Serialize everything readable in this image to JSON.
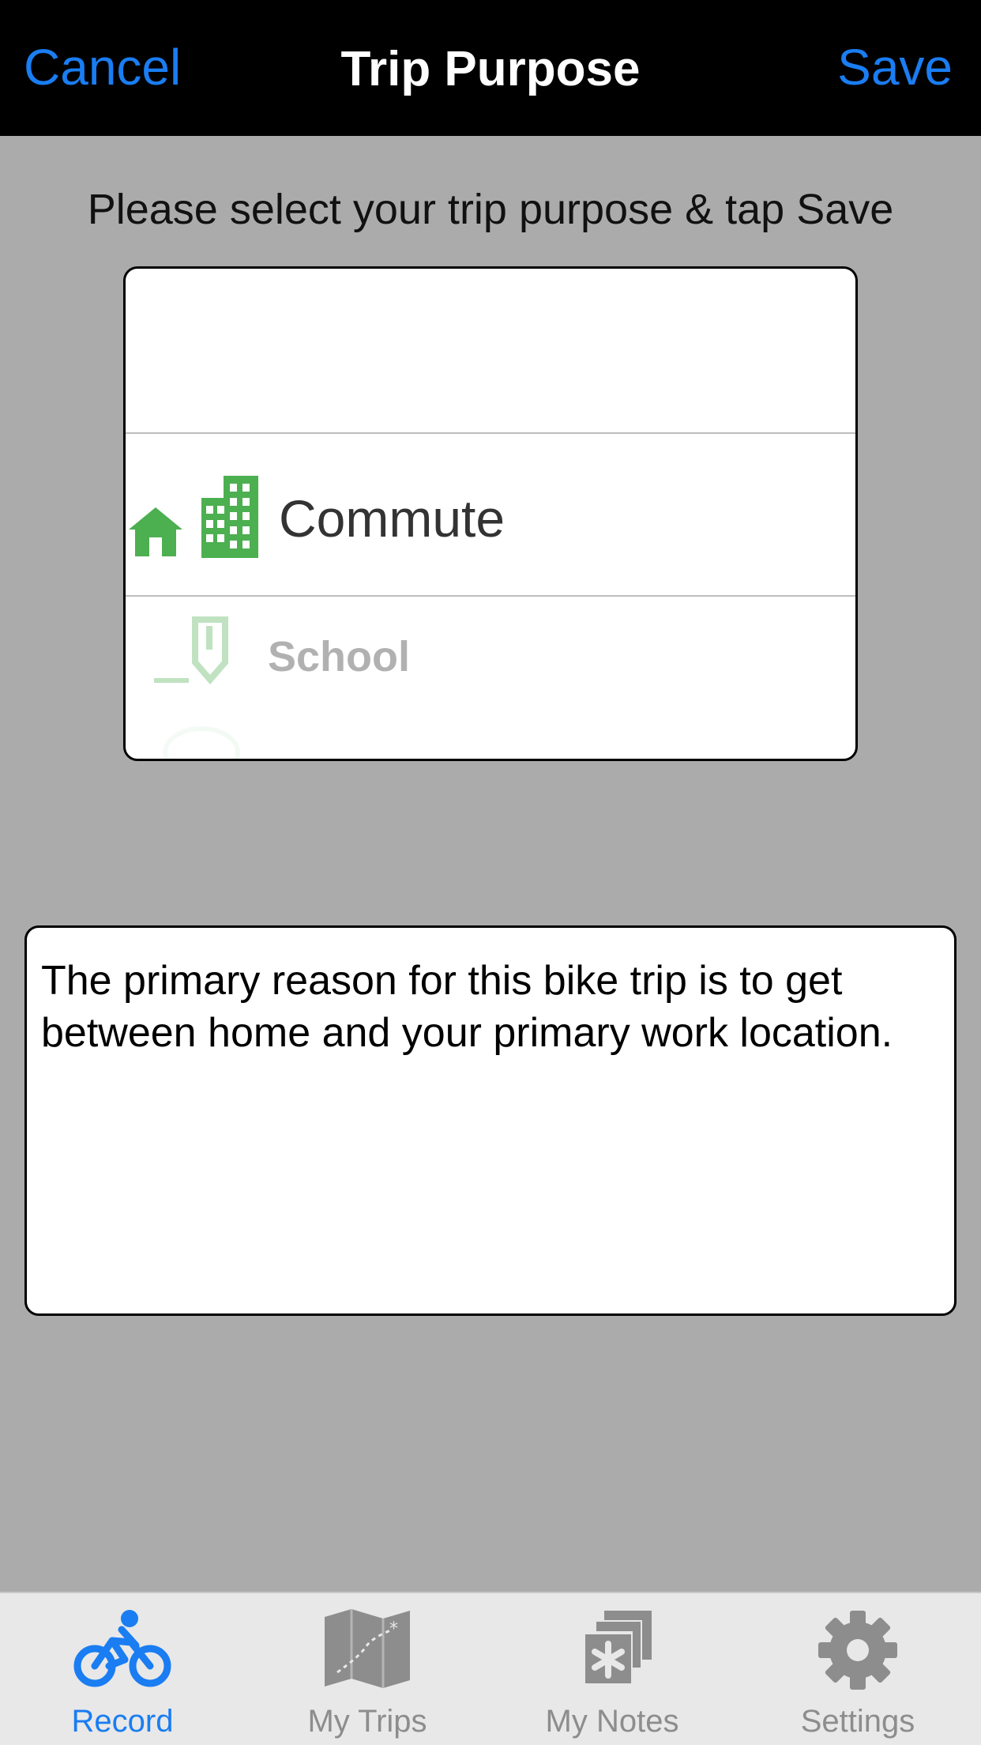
{
  "nav": {
    "cancel": "Cancel",
    "title": "Trip Purpose",
    "save": "Save"
  },
  "instruction": "Please select your trip purpose & tap Save",
  "picker": {
    "selected": {
      "label": "Commute",
      "icon": "home-building-icon"
    },
    "next": {
      "label": "School",
      "icon": "pencil-icon"
    }
  },
  "description": "The primary reason for this bike trip is to get between home and your primary work location.",
  "tabs": [
    {
      "label": "Record",
      "icon": "bike-icon",
      "active": true
    },
    {
      "label": "My Trips",
      "icon": "map-icon",
      "active": false
    },
    {
      "label": "My Notes",
      "icon": "notes-icon",
      "active": false
    },
    {
      "label": "Settings",
      "icon": "gear-icon",
      "active": false
    }
  ],
  "colors": {
    "accent": "#1a7df2",
    "icon_green": "#4caf50",
    "tab_inactive": "#8d8d8d"
  }
}
